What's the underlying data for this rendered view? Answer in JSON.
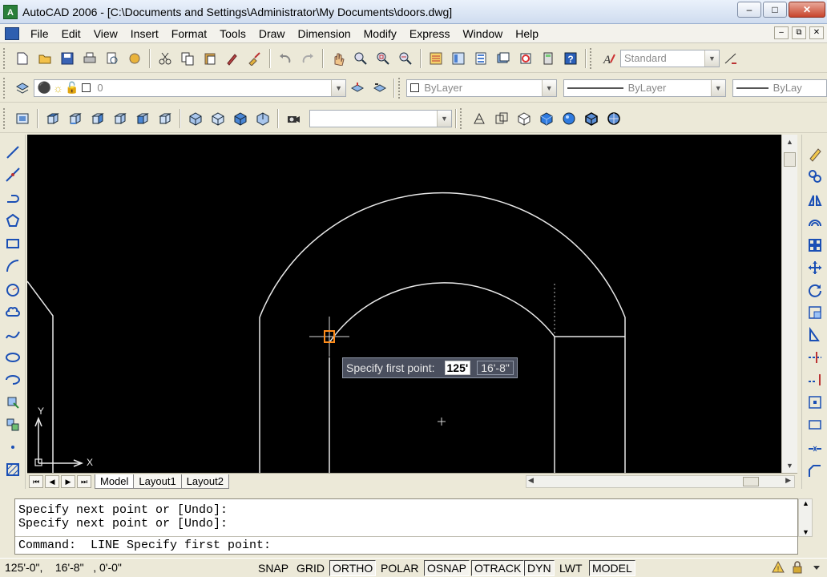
{
  "window": {
    "icon": "autocad-logo-icon",
    "title": "AutoCAD 2006 - [C:\\Documents and Settings\\Administrator\\My Documents\\doors.dwg]",
    "controls": [
      "minimize-icon",
      "maximize-icon",
      "close-icon"
    ]
  },
  "menu": {
    "items": [
      "File",
      "Edit",
      "View",
      "Insert",
      "Format",
      "Tools",
      "Draw",
      "Dimension",
      "Modify",
      "Express",
      "Window",
      "Help"
    ]
  },
  "standard_toolbar": {
    "text_style": "Standard"
  },
  "layers_toolbar": {
    "current_layer": "0"
  },
  "properties_toolbar": {
    "color": "ByLayer",
    "linetype": "ByLayer",
    "lineweight": "ByLay"
  },
  "layout_tabs": [
    "Model",
    "Layout1",
    "Layout2"
  ],
  "active_tab": "Model",
  "dynamic_input": {
    "prompt": "Specify first point:",
    "x_value": "125'",
    "y_value": "16'-8\""
  },
  "ucs": {
    "x_label": "X",
    "y_label": "Y"
  },
  "command": {
    "history": [
      "Specify next point or [Undo]:",
      "Specify next point or [Undo]:"
    ],
    "current": "Command:  LINE Specify first point:"
  },
  "status": {
    "coordinates": "125'-0\",    16'-8\"   , 0'-0\"",
    "toggles": [
      {
        "label": "SNAP",
        "on": false
      },
      {
        "label": "GRID",
        "on": false
      },
      {
        "label": "ORTHO",
        "on": true
      },
      {
        "label": "POLAR",
        "on": false
      },
      {
        "label": "OSNAP",
        "on": true
      },
      {
        "label": "OTRACK",
        "on": true
      },
      {
        "label": "DYN",
        "on": true
      },
      {
        "label": "LWT",
        "on": false
      },
      {
        "label": "MODEL",
        "on": true
      }
    ]
  },
  "colors": {
    "canvas": "#000000",
    "drawing_lines": "#ffffff",
    "cursor_marker": "#ff8c1a",
    "chrome": "#ece9d8"
  }
}
